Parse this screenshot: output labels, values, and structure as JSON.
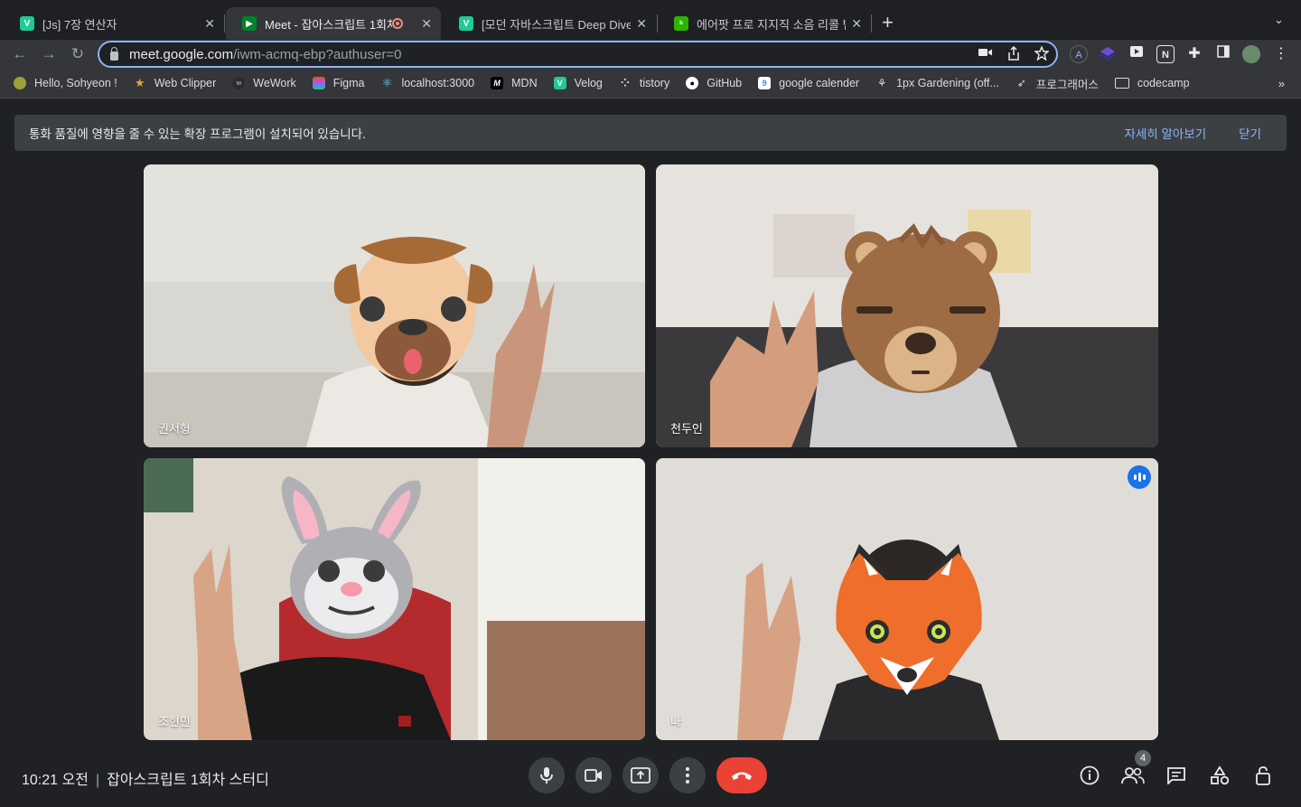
{
  "tabs": [
    {
      "title": "[Js] 7장 연산자",
      "favicon": "V"
    },
    {
      "title": "Meet - 잡아스크립트 1회차 스터디",
      "favicon": "meet"
    },
    {
      "title": "[모던 자바스크립트 Deep Dive] 04",
      "favicon": "V"
    },
    {
      "title": "에어팟 프로 지지직 소음 리콜 받기 +",
      "favicon": "blog"
    }
  ],
  "address": {
    "host": "meet.google.com",
    "path": "/iwm-acmq-ebp?authuser=0"
  },
  "bookmarks": [
    {
      "label": "Hello, Sohyeon !",
      "icon": "lemon-icon"
    },
    {
      "label": "Web Clipper",
      "icon": "medal-icon"
    },
    {
      "label": "WeWork",
      "icon": "wework-icon"
    },
    {
      "label": "Figma",
      "icon": "figma-icon"
    },
    {
      "label": "localhost:3000",
      "icon": "react-icon"
    },
    {
      "label": "MDN",
      "icon": "mdn-icon"
    },
    {
      "label": "Velog",
      "icon": "velog-icon"
    },
    {
      "label": "tistory",
      "icon": "tistory-icon"
    },
    {
      "label": "GitHub",
      "icon": "github-icon"
    },
    {
      "label": "google calender",
      "icon": "calendar-icon"
    },
    {
      "label": "1px Gardening (off...",
      "icon": "plant-icon"
    },
    {
      "label": "프로그래머스",
      "icon": "programmers-icon"
    },
    {
      "label": "codecamp",
      "icon": "folder-icon"
    }
  ],
  "banner": {
    "message": "통화 품질에 영향을 줄 수 있는 확장 프로그램이 설치되어 있습니다.",
    "learn_more": "자세히 알아보기",
    "close": "닫기"
  },
  "participants": [
    {
      "name": "권서형",
      "mask": "pug"
    },
    {
      "name": "천두인",
      "mask": "bear"
    },
    {
      "name": "조현민",
      "mask": "rabbit"
    },
    {
      "name": "나",
      "mask": "fox"
    }
  ],
  "meeting": {
    "time": "10:21 오전",
    "title": "잡아스크립트 1회차 스터디",
    "participant_count": "4"
  },
  "colors": {
    "accent": "#8ab4f8",
    "hangup": "#ea4335",
    "speaking": "#1a73e8"
  }
}
